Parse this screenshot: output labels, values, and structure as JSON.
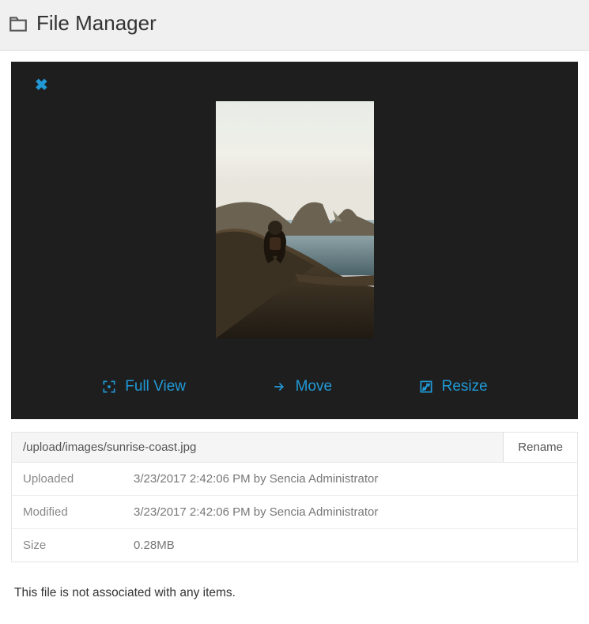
{
  "header": {
    "title": "File Manager"
  },
  "preview": {
    "actions": {
      "fullview": "Full View",
      "move": "Move",
      "resize": "Resize"
    }
  },
  "file": {
    "path": "/upload/images/sunrise-coast.jpg",
    "rename_label": "Rename",
    "meta": [
      {
        "label": "Uploaded",
        "value": "3/23/2017 2:42:06 PM by Sencia Administrator"
      },
      {
        "label": "Modified",
        "value": "3/23/2017 2:42:06 PM by Sencia Administrator"
      },
      {
        "label": "Size",
        "value": "0.28MB"
      }
    ]
  },
  "association_note": "This file is not associated with any items."
}
